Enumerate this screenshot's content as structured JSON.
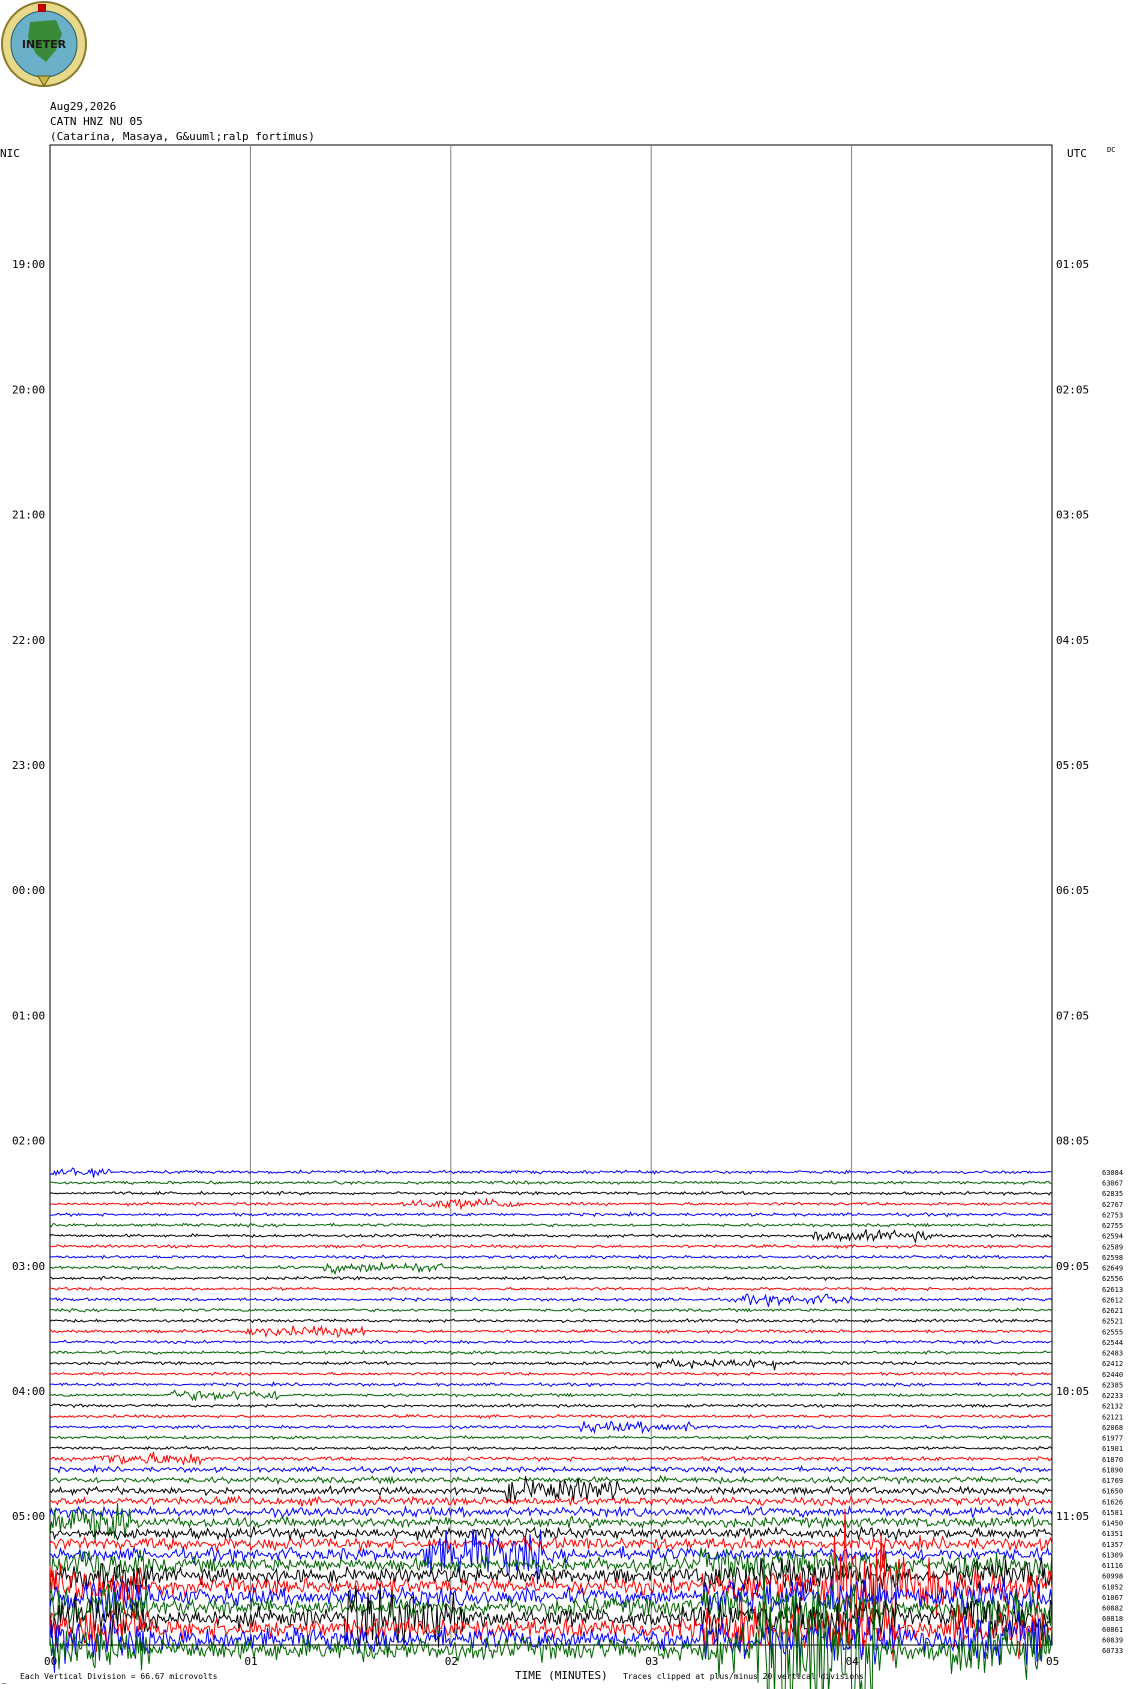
{
  "header": {
    "logo_text": "INETER",
    "date": "Aug29,2026",
    "station": "CATN HNZ NU 05",
    "location": "(Catarina, Masaya, G&uuml;ralp fortimus)",
    "left_tz": "NIC",
    "right_tz": "UTC",
    "dc": "DC"
  },
  "footer": {
    "xlabel": "TIME (MINUTES)",
    "scale_note": "Each Vertical Division =   66.67 microvolts",
    "clip_note": "Traces clipped at plus/minus 20 vertical divisions",
    "corner_mark": "‒"
  },
  "colors": {
    "trace_cycle": [
      "#0000ff",
      "#006400",
      "#000000",
      "#ff0000"
    ],
    "grid": "#808080"
  },
  "chart_data": {
    "type": "seismogram",
    "x_ticks": [
      "00",
      "01",
      "02",
      "03",
      "04",
      "05"
    ],
    "x_range_minutes": [
      0,
      5
    ],
    "left_hour_labels": [
      "19:00",
      "20:00",
      "21:00",
      "22:00",
      "23:00",
      "00:00",
      "01:00",
      "02:00",
      "03:00",
      "04:00",
      "05:00"
    ],
    "right_hour_labels": [
      "01:05",
      "02:05",
      "03:05",
      "04:05",
      "05:05",
      "06:05",
      "07:05",
      "08:05",
      "09:05",
      "10:05",
      "11:05"
    ],
    "trace_values": [
      63084,
      63067,
      62835,
      62767,
      62753,
      62755,
      62594,
      62589,
      62598,
      62649,
      62556,
      62613,
      62612,
      62621,
      62521,
      62555,
      62544,
      62483,
      62412,
      62440,
      62385,
      62233,
      62132,
      62121,
      62068,
      61977,
      61901,
      61870,
      61890,
      61769,
      61650,
      61626,
      61581,
      61450,
      61351,
      61357,
      61309,
      61116,
      60998,
      61052,
      61067,
      60882,
      60818,
      60861,
      60839,
      60733
    ],
    "active_traces_start_hour": "02:00"
  }
}
